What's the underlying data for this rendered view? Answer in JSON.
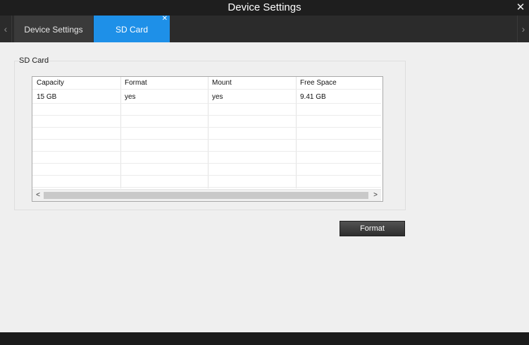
{
  "window": {
    "title": "Device Settings",
    "close_glyph": "✕"
  },
  "tabs": {
    "left_arrow": "‹",
    "right_arrow": "›",
    "items": [
      {
        "label": "Device Settings",
        "active": false
      },
      {
        "label": "SD Card",
        "active": true,
        "close_glyph": "✕"
      }
    ]
  },
  "sd_card": {
    "group_label": "SD Card",
    "columns": [
      "Capacity",
      "Format",
      "Mount",
      "Free Space"
    ],
    "rows": [
      [
        "15 GB",
        "yes",
        "yes",
        "9.41 GB"
      ]
    ],
    "scroll": {
      "left_arrow": "<",
      "right_arrow": ">"
    },
    "format_button": "Format"
  },
  "colors": {
    "accent": "#1e90e8",
    "titlebar": "#1e1e1e",
    "content_bg": "#efefef"
  }
}
